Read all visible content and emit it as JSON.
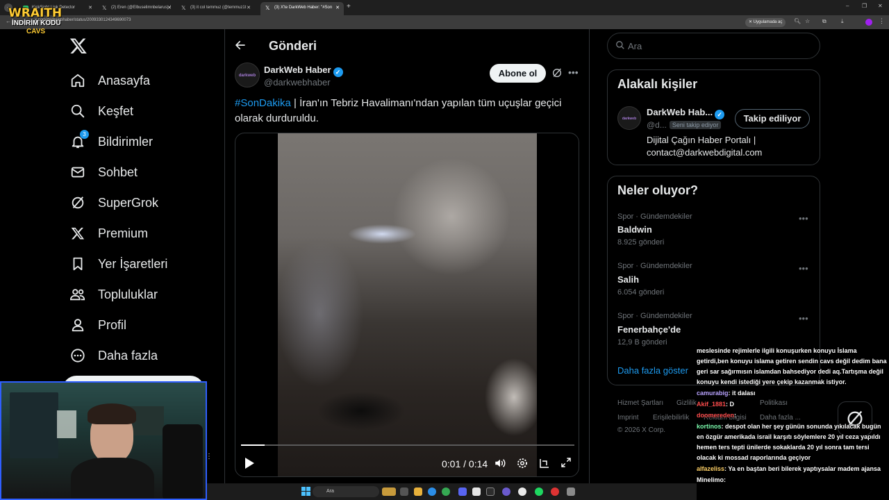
{
  "browser": {
    "tabs": [
      {
        "title": "KickSight Link Detector",
        "active": false
      },
      {
        "title": "(2) Eren (@Elbuselimnbelarus) /",
        "active": false
      },
      {
        "title": "(3) it col temmuz (@temmuz1t",
        "active": false
      },
      {
        "title": "(3) X'te DarkWeb Haber: \"#Son",
        "active": true
      }
    ],
    "url": "x.com/darkwebhaber/status/2009330124349690073",
    "open_in_app": "Uygulamada aç"
  },
  "overlay_logo": {
    "line1": "WRAITH",
    "line2": "İNDİRİM KODU",
    "line3": "CAVS"
  },
  "nav": {
    "items": [
      {
        "label": "Anasayfa",
        "icon": "home-icon"
      },
      {
        "label": "Keşfet",
        "icon": "search-icon"
      },
      {
        "label": "Bildirimler",
        "icon": "bell-icon",
        "badge": "3"
      },
      {
        "label": "Sohbet",
        "icon": "mail-icon"
      },
      {
        "label": "SuperGrok",
        "icon": "grok-icon"
      },
      {
        "label": "Premium",
        "icon": "x-icon"
      },
      {
        "label": "Yer İşaretleri",
        "icon": "bookmark-icon"
      },
      {
        "label": "Topluluklar",
        "icon": "communities-icon"
      },
      {
        "label": "Profil",
        "icon": "profile-icon"
      },
      {
        "label": "Daha fazla",
        "icon": "more-circle-icon"
      }
    ]
  },
  "header": {
    "title": "Gönderi"
  },
  "post": {
    "author_name": "DarkWeb Haber",
    "author_handle": "@darkwebhaber",
    "avatar_text": "darkweb",
    "subscribe_label": "Abone ol",
    "hashtag": "#SonDakika",
    "text": " | İran'ın Tebriz Havalimanı'ndan yapılan tüm uçuşlar geçici olarak durduruldu.",
    "video": {
      "current_time": "0:01",
      "duration": "0:14",
      "progress": 0.07
    }
  },
  "search": {
    "placeholder": "Ara"
  },
  "related": {
    "title": "Alakalı kişiler",
    "name": "DarkWeb Hab...",
    "handle": "@d...",
    "follows_you": "Seni takip ediyor",
    "follow_label": "Takip ediliyor",
    "bio_line1": "Dijital Çağın Haber Portalı |",
    "bio_line2": "contact@darkwebdigital.com"
  },
  "trends": {
    "title": "Neler oluyor?",
    "items": [
      {
        "category": "Spor · Gündemdekiler",
        "name": "Baldwin",
        "count": "8.925 gönderi"
      },
      {
        "category": "Spor · Gündemdekiler",
        "name": "Salih",
        "count": "6.054 gönderi"
      },
      {
        "category": "Spor · Gündemdekiler",
        "name": "Fenerbahçe'de",
        "count": "12,9 B gönderi"
      }
    ],
    "show_more": "Daha fazla göster"
  },
  "footer": {
    "links1": [
      "Hizmet Şartları",
      "Gizlilik",
      "Politikası"
    ],
    "links2": [
      "Imprint",
      "Erişilebilirlik",
      "Reklam bilgisi",
      "Daha fazla ..."
    ],
    "copyright": "© 2026 X Corp."
  },
  "chat": {
    "lines": [
      {
        "user": "",
        "text": "meslesinde rejimlerle ilgili konuşurken konuyu İslama getirdi,ben konuyu islama getiren sendin cavs değil dedim bana geri sar sağırmısın islamdan bahsediyor dedi aq.Tartışma değil konuyu kendi istediği yere çekip kazanmak istiyor.",
        "color": "#ffffff"
      },
      {
        "user": "camurabig",
        "text": ": it dalası",
        "color": "#b9a3ff"
      },
      {
        "user": "Akif_1881",
        "text": ": D",
        "color": "#ff4d4d"
      },
      {
        "user": "doomereden",
        "text": ":",
        "color": "#ff4d4d"
      },
      {
        "user": "kortinos",
        "text": ": despot olan her şey günün sonunda yıkılacak bugün en özgür amerikada israil karşıtı söylemlere 20 yıl ceza yapıldı hemen ters tepti ünilerde sokaklarda 20 yıl sonra tam tersi olacak ki mossad raporlarında geçiyor",
        "color": "#7dffb0"
      },
      {
        "user": "alfazeliss",
        "text": ": Ya en baştan beri bilerek yaptıysalar madem ajansa",
        "color": "#ffd166"
      },
      {
        "user": "Minelimo",
        "text": ":",
        "color": "#ffffff"
      }
    ]
  },
  "taskbar": {
    "search_placeholder": "Ara"
  },
  "colors": {
    "accent": "#1d9bf0",
    "background": "#000000",
    "border": "#2f3336",
    "muted": "#71767b"
  }
}
